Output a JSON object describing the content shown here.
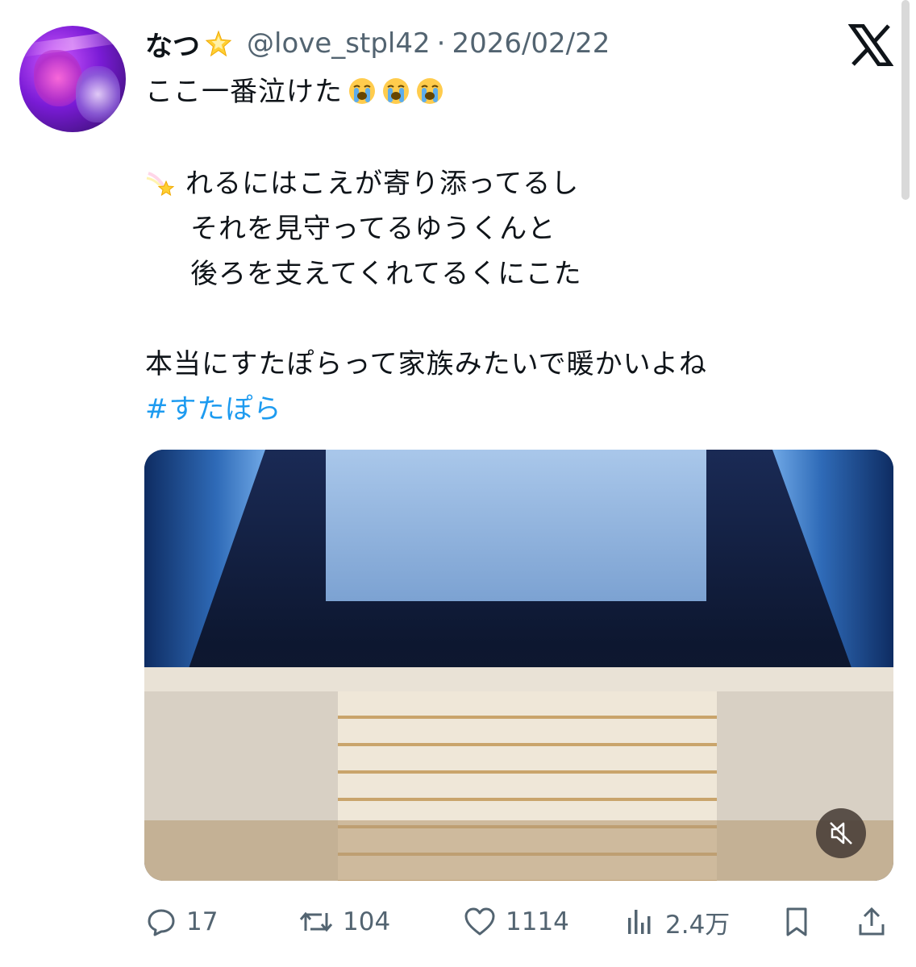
{
  "tweet": {
    "display_name": "なつ",
    "handle": "@love_stpl42",
    "separator": "·",
    "date": "2026/02/22",
    "lines": [
      "ここ一番泣けた",
      "れるにはこえが寄り添ってるし",
      "それを見守ってるゆうくんと",
      "後ろを支えてくれてるくにこた",
      "本当にすたぽらって家族みたいで暖かいよね"
    ],
    "hashtag": "#すたぽら"
  },
  "metrics": {
    "replies": "17",
    "retweets": "104",
    "likes": "1114",
    "views": "2.4万"
  },
  "icons": {
    "star": "star-emoji",
    "crying": "loudly-crying-face-emoji",
    "shooting_star": "shooting-star-emoji",
    "logo": "x-logo-icon",
    "mute": "muted-speaker-icon"
  },
  "colors": {
    "text": "#0f1419",
    "secondary": "#536471",
    "link": "#1d9bf0"
  }
}
